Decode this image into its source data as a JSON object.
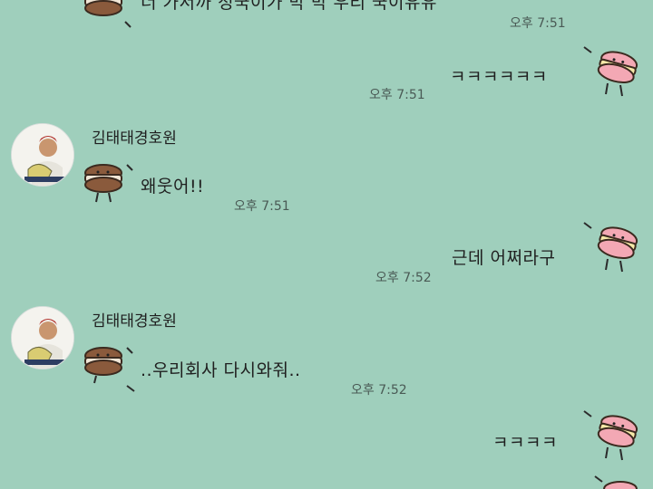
{
  "chat": {
    "messages": [
      {
        "side": "left",
        "text": "너 가서까 정국이가 막 막 우리 국이유유",
        "time": "오후 7:51"
      },
      {
        "side": "right",
        "text": "ㅋㅋㅋㅋㅋㅋ",
        "time": "오후 7:51"
      },
      {
        "side": "left",
        "sender": "김태태경호원",
        "text": "왜웃어!!",
        "time": "오후 7:51"
      },
      {
        "side": "right",
        "text": "근데 어쩌라구",
        "time": "오후 7:52"
      },
      {
        "side": "left",
        "sender": "김태태경호원",
        "text": "..우리회사 다시와줘..",
        "time": "오후 7:52"
      },
      {
        "side": "right",
        "text": "ㅋㅋㅋㅋ",
        "time": ""
      }
    ]
  },
  "icons": {
    "left_sticker": "brown-macaron-sticker",
    "right_sticker": "pink-macaron-sticker",
    "avatar": "profile-photo-avatar"
  },
  "colors": {
    "background": "#9fcfbc",
    "brown_macaron": "#8a5a3c",
    "pink_macaron": "#f3a8b4"
  }
}
